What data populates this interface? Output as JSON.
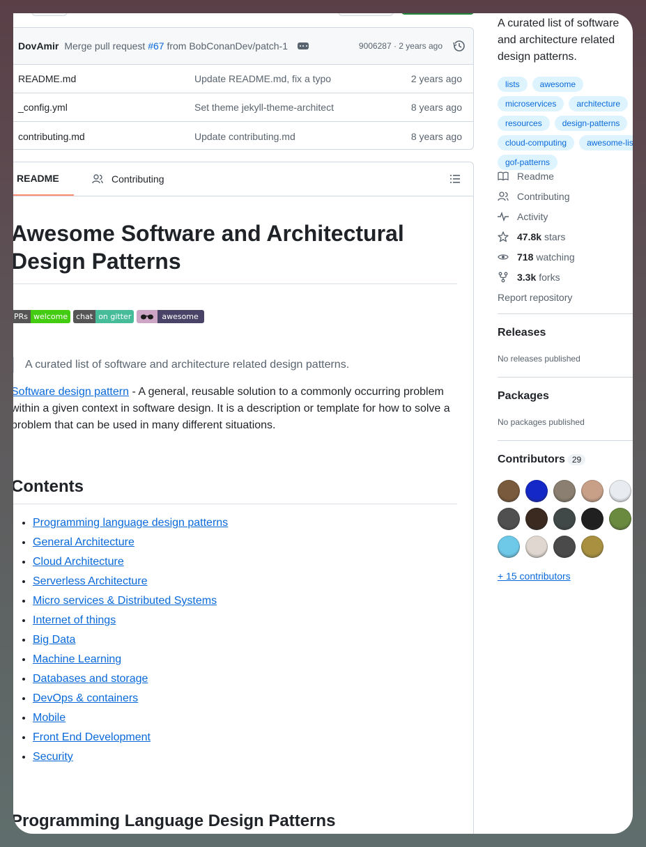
{
  "commit": {
    "author": "DovAmir",
    "message_prefix": "Merge pull request",
    "pr_number": "#67",
    "message_suffix": "from BobConanDev/patch-1",
    "meta": "9006287 · 2 years ago"
  },
  "files": [
    {
      "name": "README.md",
      "message": "Update README.md, fix a typo",
      "age": "2 years ago"
    },
    {
      "name": "_config.yml",
      "message": "Set theme jekyll-theme-architect",
      "age": "8 years ago"
    },
    {
      "name": "contributing.md",
      "message": "Update contributing.md",
      "age": "8 years ago"
    }
  ],
  "tabs": {
    "readme": "README",
    "contributing": "Contributing"
  },
  "readme": {
    "title": "Awesome Software and Architectural Design Patterns",
    "badges": [
      {
        "left": "PRs",
        "right": "welcome",
        "left_color": "#555555",
        "right_color": "#4c1"
      },
      {
        "left": "chat",
        "right": "on gitter",
        "left_color": "#555555",
        "right_color": "#46bc99"
      },
      {
        "left": "",
        "right": "awesome",
        "left_color": "#cca6c4",
        "right_color": "#494368"
      }
    ],
    "blockquote": "A curated list of software and architecture related design patterns.",
    "desc_link": "Software design pattern",
    "desc_text": " - A general, reusable solution to a commonly occurring problem within a given context in software design. It is a description or template for how to solve a problem that can be used in many different situations.",
    "contents_heading": "Contents",
    "toc": [
      "Programming language design patterns",
      "General Architecture",
      "Cloud Architecture",
      "Serverless Architecture",
      "Micro services & Distributed Systems",
      "Internet of things",
      "Big Data",
      "Machine Learning",
      "Databases and storage",
      "DevOps & containers",
      "Mobile",
      "Front End Development",
      "Security"
    ],
    "next_heading": "Programming Language Design Patterns"
  },
  "sidebar": {
    "about": "A curated list of software and architecture related design patterns.",
    "topics": [
      "lists",
      "awesome",
      "microservices",
      "architecture",
      "resources",
      "design-patterns",
      "cloud-computing",
      "awesome-list",
      "gof-patterns"
    ],
    "readme": "Readme",
    "contributing": "Contributing",
    "activity": "Activity",
    "stars_count": "47.8k",
    "stars_label": "stars",
    "watching_count": "718",
    "watching_label": "watching",
    "forks_count": "3.3k",
    "forks_label": "forks",
    "report": "Report repository",
    "releases_title": "Releases",
    "releases_sub": "No releases published",
    "packages_title": "Packages",
    "packages_sub": "No packages published",
    "contributors_title": "Contributors",
    "contributors_count": "29",
    "more_contributors": "+ 15 contributors",
    "avatar_colors": [
      "#7a5a3c",
      "#1428c8",
      "#8a7f70",
      "#c8a088",
      "#e8ecf0",
      "#505050",
      "#3a2a20",
      "#404848",
      "#202020",
      "#6a8a40",
      "#6ec8e8",
      "#e0d8d0",
      "#4a4a4a",
      "#a89040"
    ]
  }
}
